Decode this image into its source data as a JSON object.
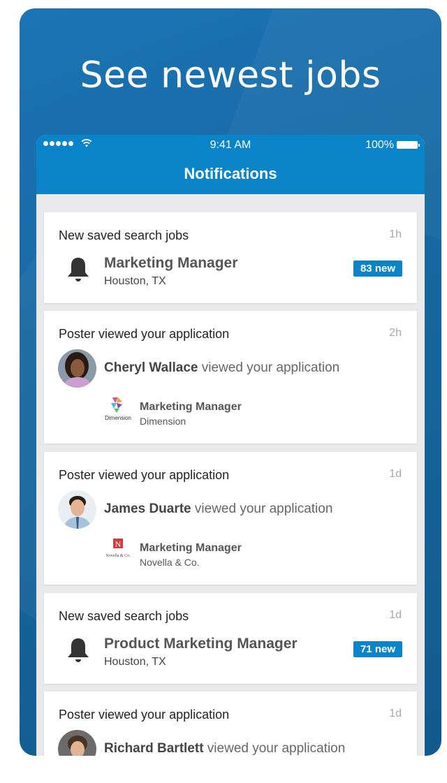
{
  "promo": {
    "title": "See newest jobs"
  },
  "status_bar": {
    "time": "9:41 AM",
    "battery": "100%"
  },
  "nav": {
    "title": "Notifications"
  },
  "cards": [
    {
      "type": "saved_search",
      "heading": "New saved search jobs",
      "time": "1h",
      "icon": "bell-icon",
      "job_title": "Marketing Manager",
      "location": "Houston, TX",
      "badge": "83 new"
    },
    {
      "type": "viewed",
      "heading": "Poster viewed your application",
      "time": "2h",
      "viewer_name": "Cheryl Wallace",
      "viewer_action": " viewed your application",
      "job_title": "Marketing Manager",
      "company": "Dimension",
      "logo_text": "Dimension"
    },
    {
      "type": "viewed",
      "heading": "Poster viewed your application",
      "time": "1d",
      "viewer_name": "James Duarte",
      "viewer_action": " viewed your application",
      "job_title": "Marketing Manager",
      "company": "Novella & Co.",
      "logo_text": "Novella & Co."
    },
    {
      "type": "saved_search",
      "heading": "New saved search jobs",
      "time": "1d",
      "icon": "bell-icon",
      "job_title": "Product Marketing Manager",
      "location": "Houston, TX",
      "badge": "71 new"
    },
    {
      "type": "viewed",
      "heading": "Poster viewed your application",
      "time": "1d",
      "viewer_name": "Richard Bartlett",
      "viewer_action": " viewed your application"
    }
  ],
  "colors": {
    "brand_blue": "#0a84c8",
    "promo_bg": "#16679f"
  }
}
